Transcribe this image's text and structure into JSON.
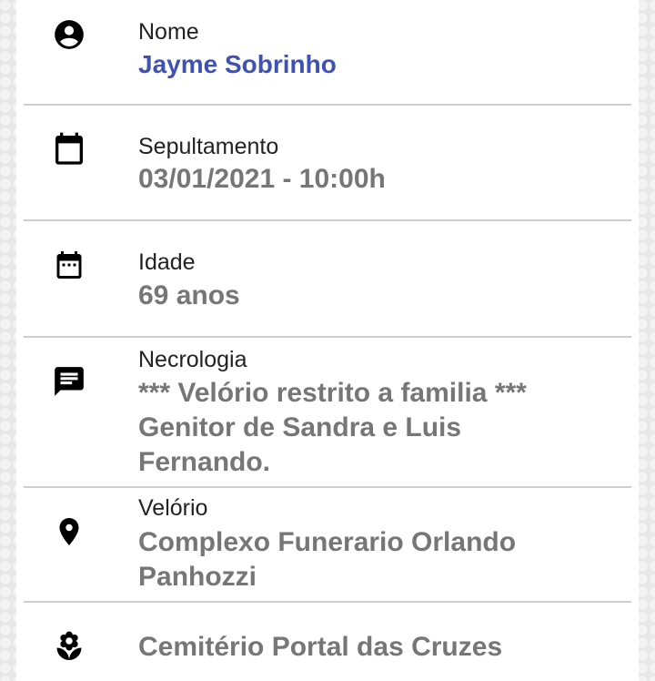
{
  "colors": {
    "name_value": "#3f51b5",
    "value": "#767676",
    "label": "#222222",
    "divider": "#cfcfcf"
  },
  "rows": [
    {
      "icon": "account-circle-icon",
      "label": "Nome",
      "value": "Jayme Sobrinho"
    },
    {
      "icon": "calendar-icon",
      "label": "Sepultamento",
      "value": "03/01/2021 - 10:00h"
    },
    {
      "icon": "calendar-dots-icon",
      "label": "Idade",
      "value": "69 anos"
    },
    {
      "icon": "message-icon",
      "label": "Necrologia",
      "value_lines": [
        "*** Velório restrito a familia ***",
        "Genitor de Sandra e Luis",
        "Fernando."
      ]
    },
    {
      "icon": "location-pin-icon",
      "label": "Velório",
      "value_lines": [
        "Complexo Funerario Orlando",
        "Panhozzi"
      ]
    },
    {
      "icon": "flower-icon",
      "value": "Cemitério Portal das Cruzes"
    }
  ]
}
